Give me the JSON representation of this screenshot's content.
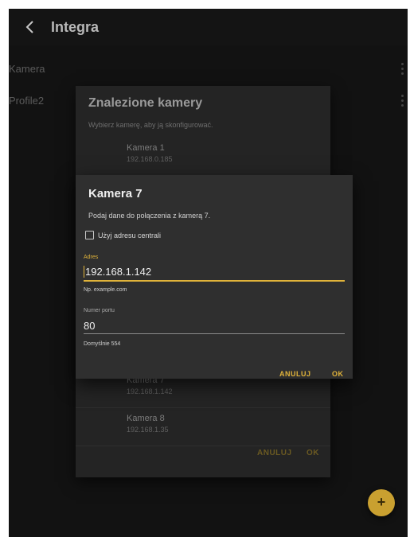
{
  "app": {
    "title": "Integra"
  },
  "list": {
    "items": [
      {
        "label": "Kamera"
      },
      {
        "label": "Profile2"
      }
    ]
  },
  "found_dialog": {
    "title": "Znalezione kamery",
    "subtitle": "Wybierz kamerę, aby ją skonfigurować.",
    "cameras": [
      {
        "name": "Kamera 1",
        "ip": "192.168.0.185"
      },
      {
        "name": "Kamera 7",
        "ip": "192.168.1.142"
      },
      {
        "name": "Kamera 8",
        "ip": "192.168.1.35"
      }
    ],
    "cancel_label": "ANULUJ",
    "ok_label": "OK"
  },
  "camera_dialog": {
    "title": "Kamera 7",
    "subtitle": "Podaj dane do połączenia z kamerą 7.",
    "use_central_address": {
      "label": "Użyj adresu centrali",
      "checked": false
    },
    "address": {
      "label": "Adres",
      "value": "192.168.1.142",
      "helper": "Np. example.com"
    },
    "port": {
      "label": "Numer portu",
      "value": "80",
      "helper": "Domyślnie 554"
    },
    "cancel_label": "ANULUJ",
    "ok_label": "OK"
  },
  "fab": {
    "label": "+"
  },
  "colors": {
    "accent": "#e0b33a",
    "background": "#1c1c1c",
    "dialog": "#2f2f2f"
  },
  "icons": {
    "back": "chevron-left-icon",
    "menu": "kebab-menu-icon",
    "add": "plus-icon"
  }
}
